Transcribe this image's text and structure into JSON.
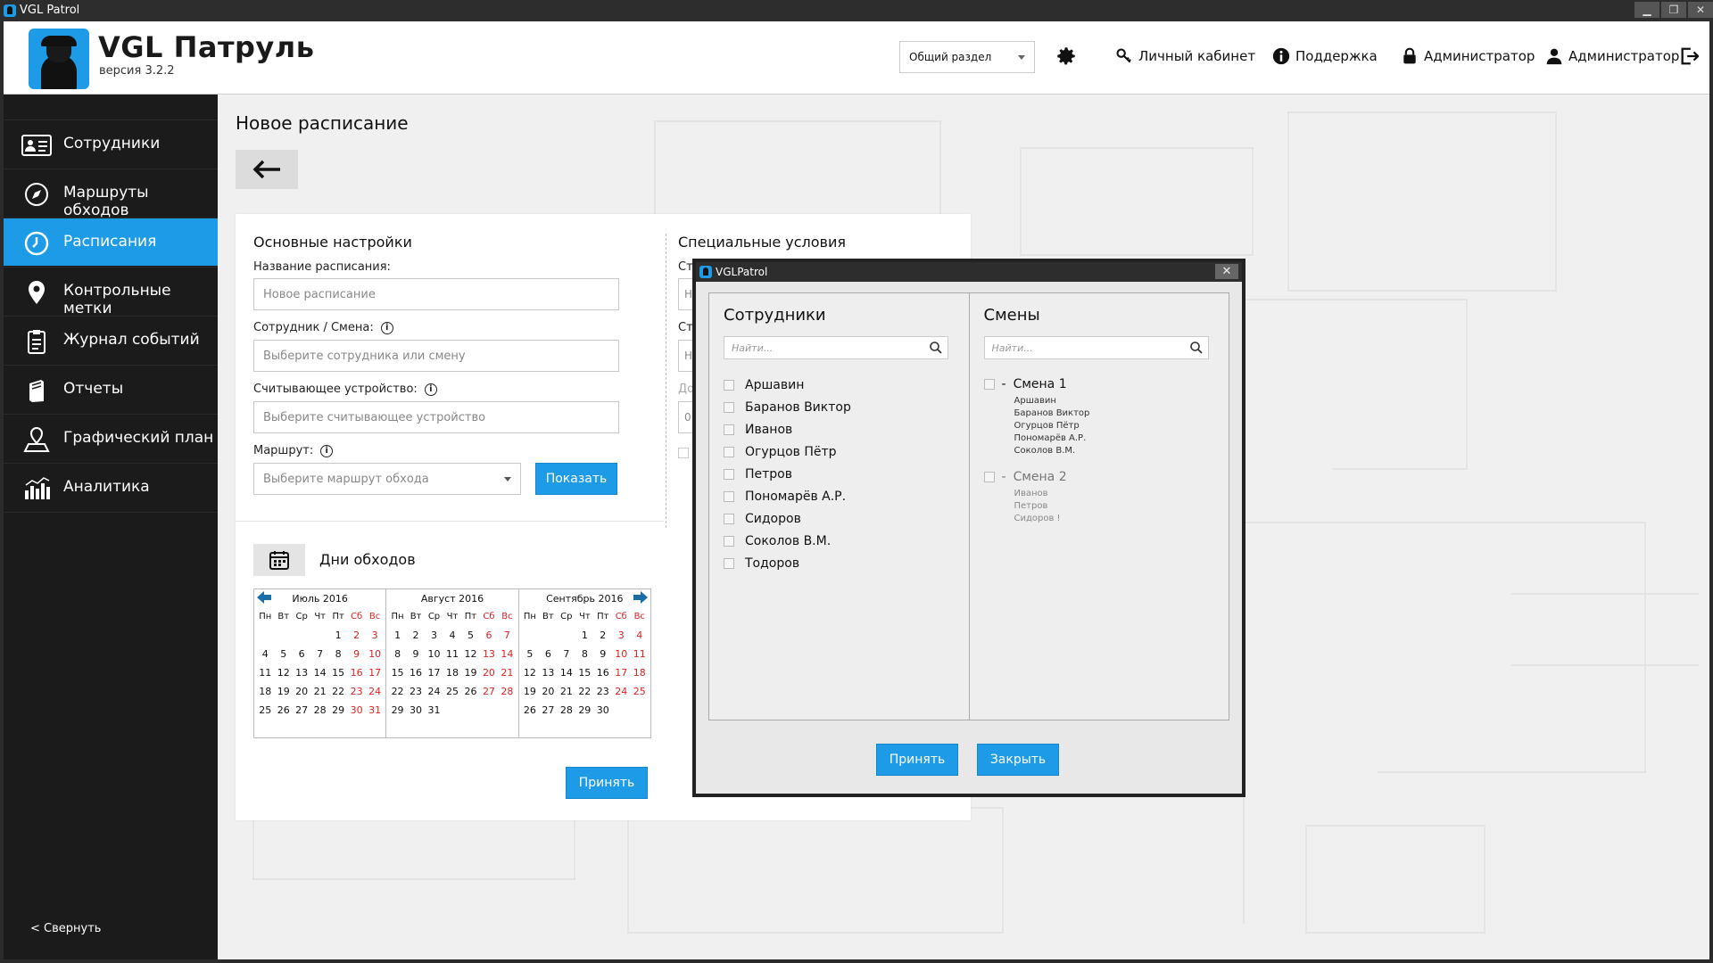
{
  "window": {
    "title": "VGL Patrol",
    "min": "▁",
    "max": "❐",
    "close": "✕"
  },
  "header": {
    "brand": "VGL Патруль",
    "version": "версия 3.2.2",
    "section_select": "Общий раздел",
    "links": {
      "cabinet": "Личный кабинет",
      "support": "Поддержка",
      "admin_lock": "Администратор",
      "admin_user": "Администратор"
    }
  },
  "sidebar": {
    "items": [
      {
        "label": "Сотрудники",
        "icon": "id-card-icon"
      },
      {
        "label": "Маршруты обходов",
        "icon": "compass-icon"
      },
      {
        "label": "Расписания",
        "icon": "clock-icon"
      },
      {
        "label": "Контрольные метки",
        "icon": "map-pin-icon"
      },
      {
        "label": "Журнал событий",
        "icon": "clipboard-icon"
      },
      {
        "label": "Отчеты",
        "icon": "report-book-icon"
      },
      {
        "label": "Графический план",
        "icon": "map-icon"
      },
      {
        "label": "Аналитика",
        "icon": "analytics-icon"
      }
    ],
    "active_index": 2,
    "collapse": "< Свернуть"
  },
  "page": {
    "title": "Новое расписание",
    "basic": {
      "heading": "Основные настройки",
      "name_label": "Название расписания:",
      "name_placeholder": "Новое расписание",
      "employee_label": "Сотрудник / Смена:",
      "employee_placeholder": "Выберите сотрудника или смену",
      "device_label": "Считывающее устройство:",
      "device_placeholder": "Выберите считывающее устройство",
      "route_label": "Маршрут:",
      "route_placeholder": "Выберите маршрут обхода",
      "show_button": "Показать"
    },
    "special": {
      "heading": "Специальные условия",
      "peek": [
        "Ст",
        "Н",
        "Ст",
        "Н",
        "До",
        "0"
      ]
    },
    "days": {
      "heading": "Дни обходов"
    },
    "accept_button": "Принять"
  },
  "calendar": {
    "weekdays": [
      "Пн",
      "Вт",
      "Ср",
      "Чт",
      "Пт",
      "Сб",
      "Вс"
    ],
    "months": [
      {
        "title": "Июль 2016",
        "offset": 4,
        "days": 31
      },
      {
        "title": "Август 2016",
        "offset": 0,
        "days": 31
      },
      {
        "title": "Сентябрь 2016",
        "offset": 3,
        "days": 30
      }
    ]
  },
  "dialog": {
    "title": "VGLPatrol",
    "close": "✕",
    "employees": {
      "heading": "Сотрудники",
      "search_placeholder": "Найти...",
      "items": [
        "Аршавин",
        "Баранов Виктор",
        "Иванов",
        "Огурцов Пётр",
        "Петров",
        "Пономарёв А.Р.",
        "Сидоров",
        "Соколов В.М.",
        "Тодоров"
      ]
    },
    "shifts": {
      "heading": "Смены",
      "search_placeholder": "Найти...",
      "items": [
        {
          "name": "Смена 1",
          "toggle": "-",
          "members": [
            "Аршавин",
            "Баранов Виктор",
            "Огурцов Пётр",
            "Пономарёв А.Р.",
            "Соколов В.М."
          ]
        },
        {
          "name": "Смена 2",
          "toggle": "-",
          "members": [
            "Иванов",
            "Петров",
            "Сидоров !"
          ]
        }
      ]
    },
    "accept_button": "Принять",
    "close_button": "Закрыть"
  },
  "colors": {
    "accent": "#1e9be6",
    "sidebar_bg": "#1b1b1b",
    "weekend": "#e02020"
  }
}
